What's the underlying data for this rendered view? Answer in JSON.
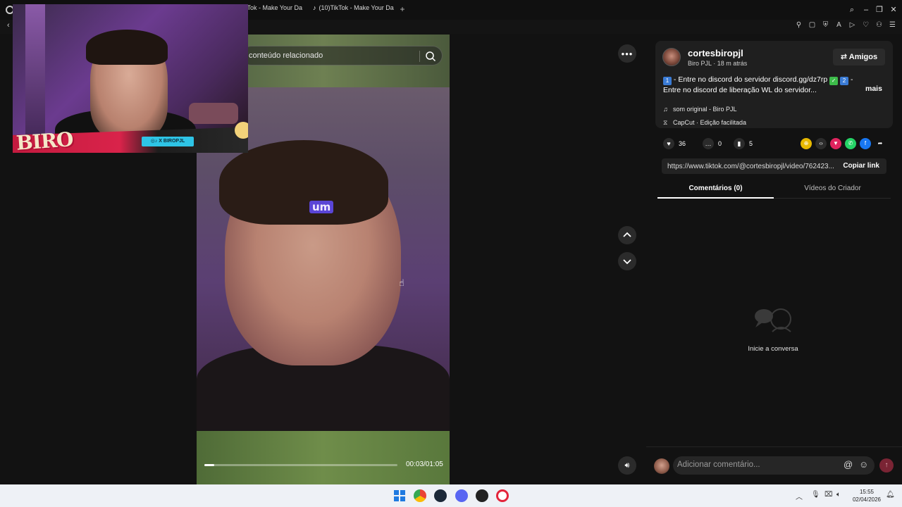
{
  "browser": {
    "tabs": [
      {
        "label": "kTok - Make Your Da"
      },
      {
        "label": "(10)TikTok - Make Your Da"
      }
    ]
  },
  "search": {
    "placeholder": "conteúdo relacionado"
  },
  "video": {
    "caption": "um",
    "time": "00:03/01:05",
    "progress_fraction": 0.05
  },
  "overlay": {
    "logo_text": "BIRO",
    "handle_tag": "◎♪ X BIROPJL"
  },
  "post": {
    "username": "cortesbiropjl",
    "author": "Biro PJL",
    "age": "18 m atrás",
    "follow_button": "Amigos",
    "description_badge1": "1",
    "description_part1": " - Entre no discord do servidor discord.gg/dz7rp ",
    "description_check": "✓",
    "description_badge2": "2",
    "description_part2": " - Entre no discord de liberação WL do servidor...",
    "more": "mais",
    "music": "som original - Biro PJL",
    "capcut": "CapCut · Edição facilitada"
  },
  "actions": {
    "likes": "36",
    "comments": "0",
    "saves": "5"
  },
  "link": {
    "url": "https://www.tiktok.com/@cortesbiropjl/video/762423...",
    "copy": "Copiar link"
  },
  "panel_tabs": {
    "comments": "Comentários (0)",
    "creator_videos": "Vídeos do Criador"
  },
  "empty_state": {
    "text": "Inicie a conversa"
  },
  "comment_bar": {
    "placeholder": "Adicionar comentário..."
  },
  "taskbar": {
    "time": "15:55",
    "date": "02/04/2026"
  },
  "colors": {
    "accent_send": "#7a2434",
    "caption_bg": "#5a45d6",
    "page_bg": "#121212"
  },
  "icons": [
    "opera-icon",
    "search-icon",
    "more-icon",
    "chevron-up-icon",
    "chevron-down-icon",
    "volume-icon",
    "heart-icon",
    "comment-icon",
    "bookmark-icon",
    "music-icon",
    "capcut-icon",
    "share-arrow-icon",
    "at-icon",
    "emoji-icon",
    "send-icon"
  ]
}
